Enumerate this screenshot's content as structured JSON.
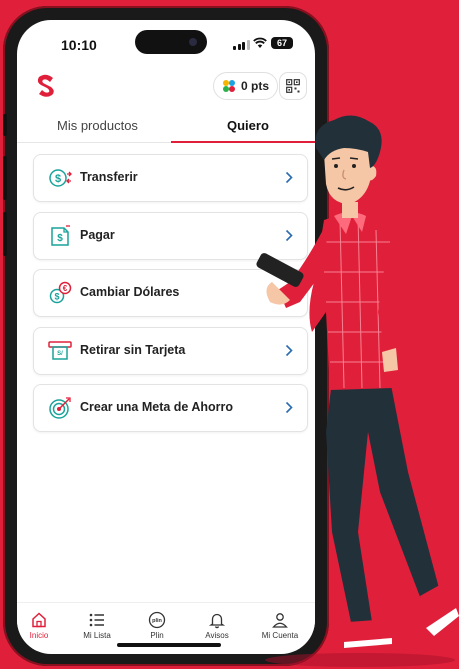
{
  "status": {
    "time": "10:10",
    "battery": "67"
  },
  "header": {
    "points": "0 pts"
  },
  "tabs": [
    {
      "label": "Mis productos",
      "active": false
    },
    {
      "label": "Quiero",
      "active": true
    }
  ],
  "options": [
    {
      "label": "Transferir",
      "icon": "dollar-transfer-icon"
    },
    {
      "label": "Pagar",
      "icon": "bill-pay-icon"
    },
    {
      "label": "Cambiar Dólares",
      "icon": "currency-exchange-icon"
    },
    {
      "label": "Retirar sin Tarjeta",
      "icon": "cash-withdraw-icon"
    },
    {
      "label": "Crear una Meta de Ahorro",
      "icon": "target-icon"
    }
  ],
  "nav": [
    {
      "label": "Inicio",
      "icon": "home-icon",
      "active": true
    },
    {
      "label": "Mi Lista",
      "icon": "list-icon",
      "active": false
    },
    {
      "label": "Plin",
      "icon": "plin-icon",
      "active": false
    },
    {
      "label": "Avisos",
      "icon": "bell-icon",
      "active": false
    },
    {
      "label": "Mi Cuenta",
      "icon": "user-icon",
      "active": false
    }
  ],
  "colors": {
    "brand": "#e0203a",
    "background": "#e0203a",
    "text": "#222222"
  }
}
